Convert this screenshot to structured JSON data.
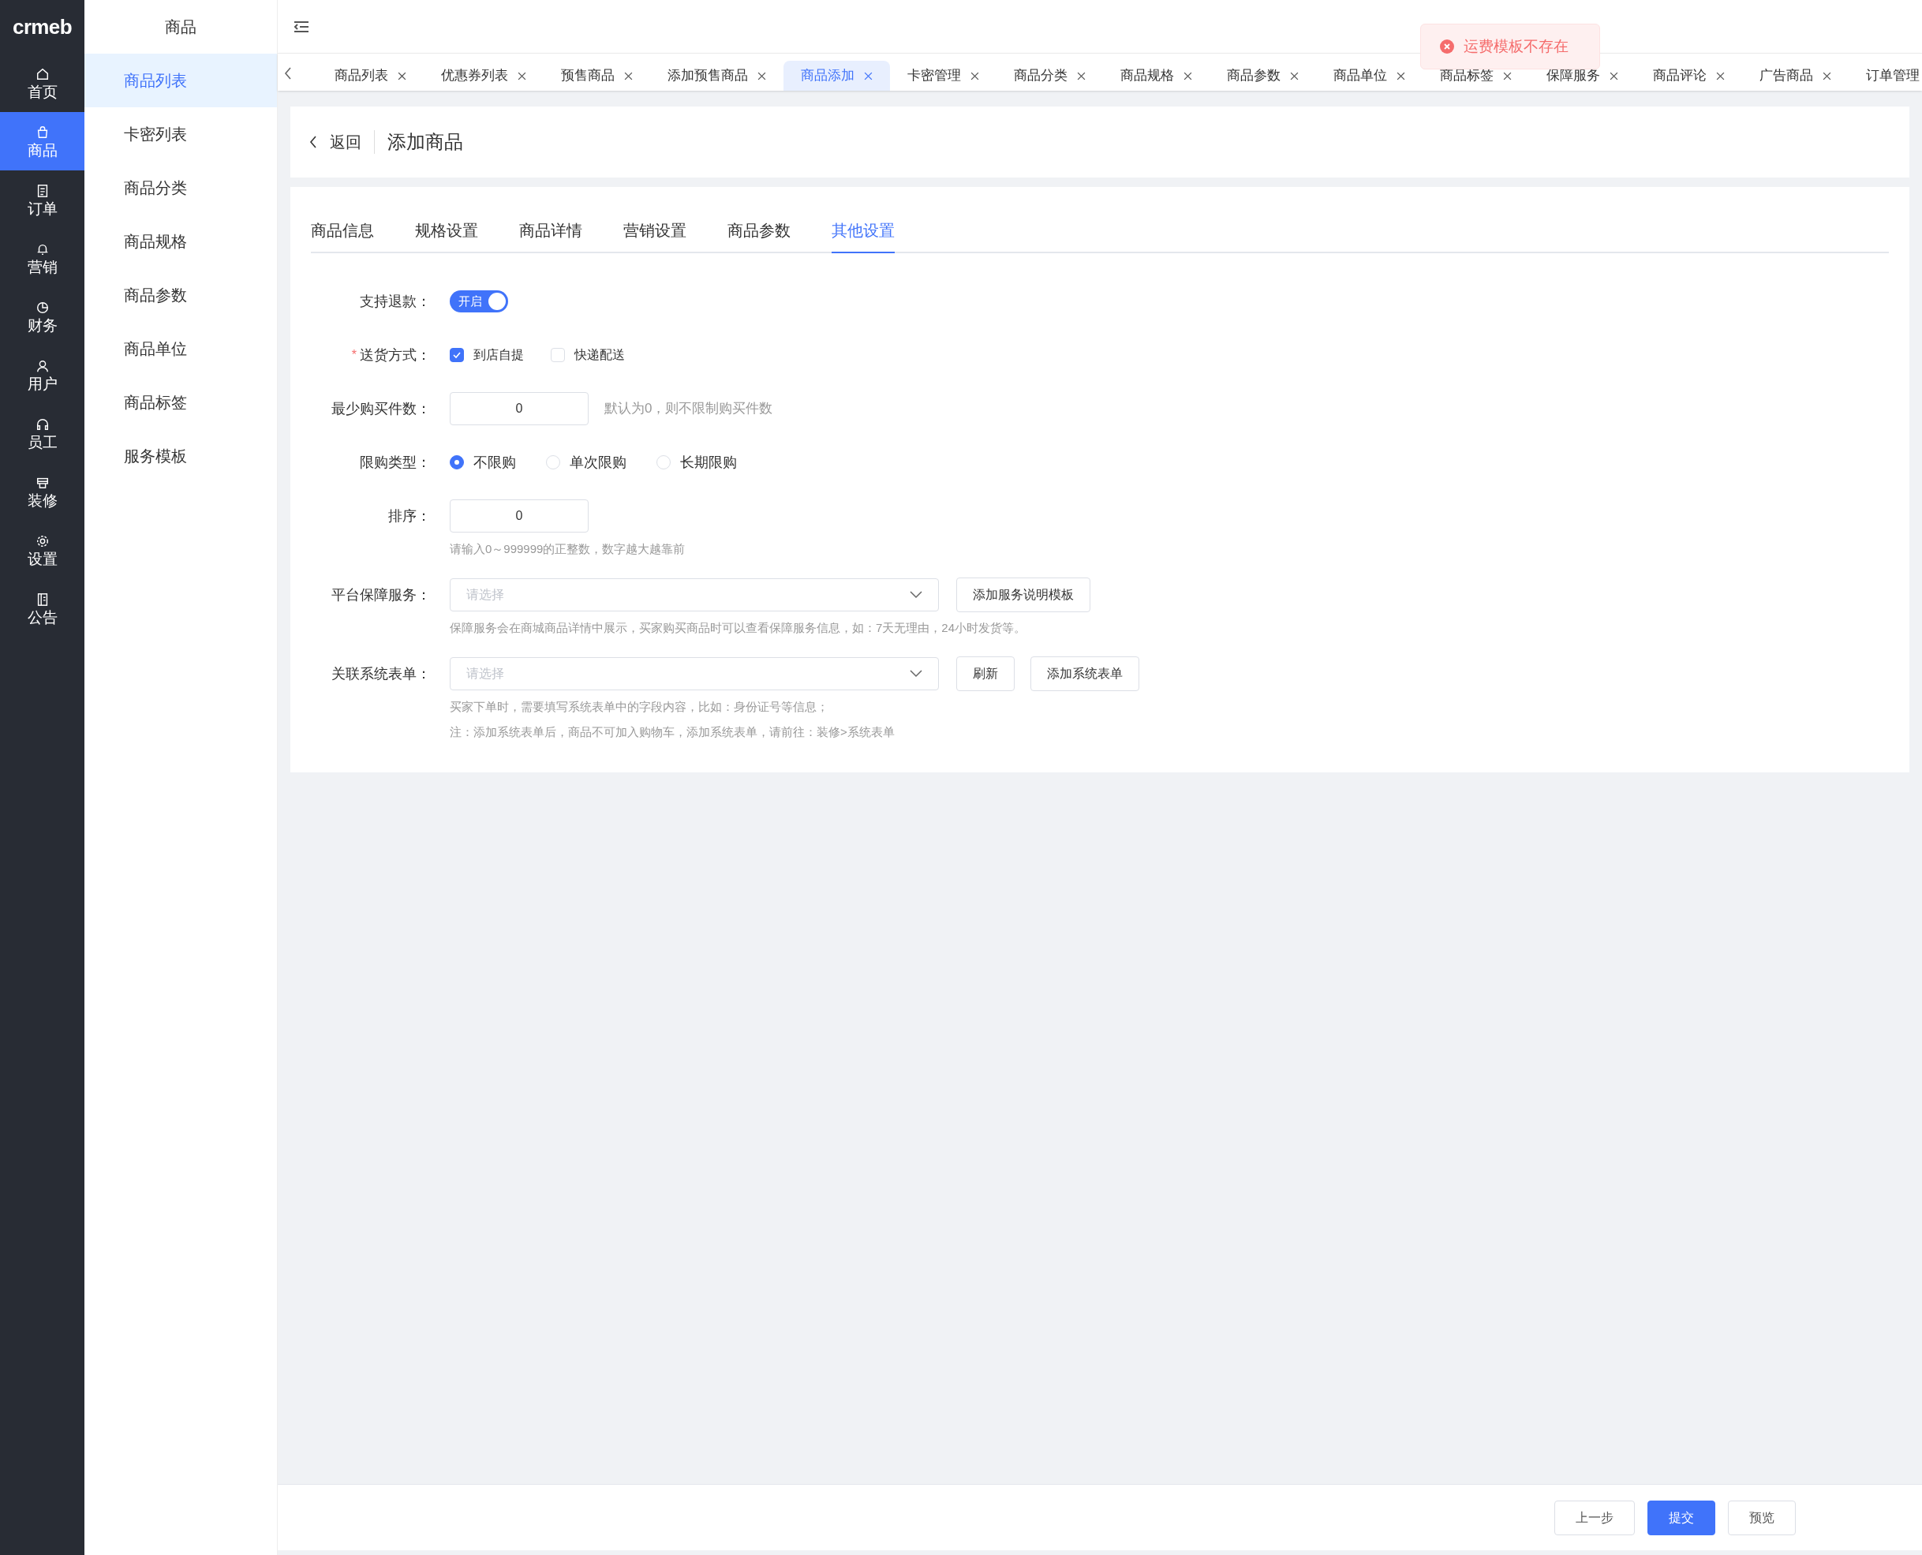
{
  "logo": "crmeb",
  "rail": [
    {
      "label": "首页",
      "selected": false
    },
    {
      "label": "商品",
      "selected": true
    },
    {
      "label": "订单",
      "selected": false
    },
    {
      "label": "营销",
      "selected": false
    },
    {
      "label": "财务",
      "selected": false
    },
    {
      "label": "用户",
      "selected": false
    },
    {
      "label": "员工",
      "selected": false
    },
    {
      "label": "装修",
      "selected": false
    },
    {
      "label": "设置",
      "selected": false
    },
    {
      "label": "公告",
      "selected": false
    }
  ],
  "submenu": {
    "title": "商品",
    "items": [
      {
        "label": "商品列表",
        "selected": true
      },
      {
        "label": "卡密列表",
        "selected": false
      },
      {
        "label": "商品分类",
        "selected": false
      },
      {
        "label": "商品规格",
        "selected": false
      },
      {
        "label": "商品参数",
        "selected": false
      },
      {
        "label": "商品单位",
        "selected": false
      },
      {
        "label": "商品标签",
        "selected": false
      },
      {
        "label": "服务模板",
        "selected": false
      }
    ]
  },
  "tabs": [
    {
      "label": "商品列表",
      "selected": false,
      "closable": true
    },
    {
      "label": "优惠券列表",
      "selected": false,
      "closable": true
    },
    {
      "label": "预售商品",
      "selected": false,
      "closable": true
    },
    {
      "label": "添加预售商品",
      "selected": false,
      "closable": true
    },
    {
      "label": "商品添加",
      "selected": true,
      "closable": true
    },
    {
      "label": "卡密管理",
      "selected": false,
      "closable": true
    },
    {
      "label": "商品分类",
      "selected": false,
      "closable": true
    },
    {
      "label": "商品规格",
      "selected": false,
      "closable": true
    },
    {
      "label": "商品参数",
      "selected": false,
      "closable": true
    },
    {
      "label": "商品单位",
      "selected": false,
      "closable": true
    },
    {
      "label": "商品标签",
      "selected": false,
      "closable": true
    },
    {
      "label": "保障服务",
      "selected": false,
      "closable": true
    },
    {
      "label": "商品评论",
      "selected": false,
      "closable": true
    },
    {
      "label": "广告商品",
      "selected": false,
      "closable": true
    },
    {
      "label": "订单管理",
      "selected": false,
      "closable": false
    }
  ],
  "toast": {
    "kind": "error",
    "message": "运费模板不存在"
  },
  "page_header": {
    "back": "返回",
    "title": "添加商品"
  },
  "form_tabs": [
    {
      "label": "商品信息",
      "selected": false
    },
    {
      "label": "规格设置",
      "selected": false
    },
    {
      "label": "商品详情",
      "selected": false
    },
    {
      "label": "营销设置",
      "selected": false
    },
    {
      "label": "商品参数",
      "selected": false
    },
    {
      "label": "其他设置",
      "selected": true
    }
  ],
  "form": [
    {
      "kind": "switch",
      "label": "支持退款：",
      "on": true,
      "text": "开启"
    },
    {
      "kind": "checkboxes",
      "label": "送货方式：",
      "marker": "*",
      "options": [
        {
          "label": "到店自提",
          "checked": true
        },
        {
          "label": "快递配送",
          "checked": false
        }
      ]
    },
    {
      "kind": "input",
      "label": "最少购买件数：",
      "value": "0",
      "aside": "默认为0，则不限制购买件数"
    },
    {
      "kind": "radios",
      "label": "限购类型：",
      "options": [
        {
          "label": "不限购",
          "selected": true
        },
        {
          "label": "单次限购",
          "selected": false
        },
        {
          "label": "长期限购",
          "selected": false
        }
      ]
    },
    {
      "kind": "input",
      "label": "排序：",
      "value": "0",
      "hints": [
        "请输入0～999999的正整数，数字越大越靠前"
      ]
    },
    {
      "kind": "select",
      "label": "平台保障服务：",
      "placeholder": "请选择",
      "buttons": [
        "添加服务说明模板"
      ],
      "hints": [
        "保障服务会在商城商品详情中展示，买家购买商品时可以查看保障服务信息，如：7天无理由，24小时发货等。"
      ]
    },
    {
      "kind": "select",
      "label": "关联系统表单：",
      "placeholder": "请选择",
      "buttons": [
        "刷新",
        "添加系统表单"
      ],
      "hints": [
        "买家下单时，需要填写系统表单中的字段内容，比如：身份证号等信息；",
        "注：添加系统表单后，商品不可加入购物车，添加系统表单，请前往：装修>系统表单"
      ]
    }
  ],
  "footer_buttons": [
    {
      "label": "上一步",
      "primary": false
    },
    {
      "label": "提交",
      "primary": true
    },
    {
      "label": "预览",
      "primary": false
    }
  ]
}
